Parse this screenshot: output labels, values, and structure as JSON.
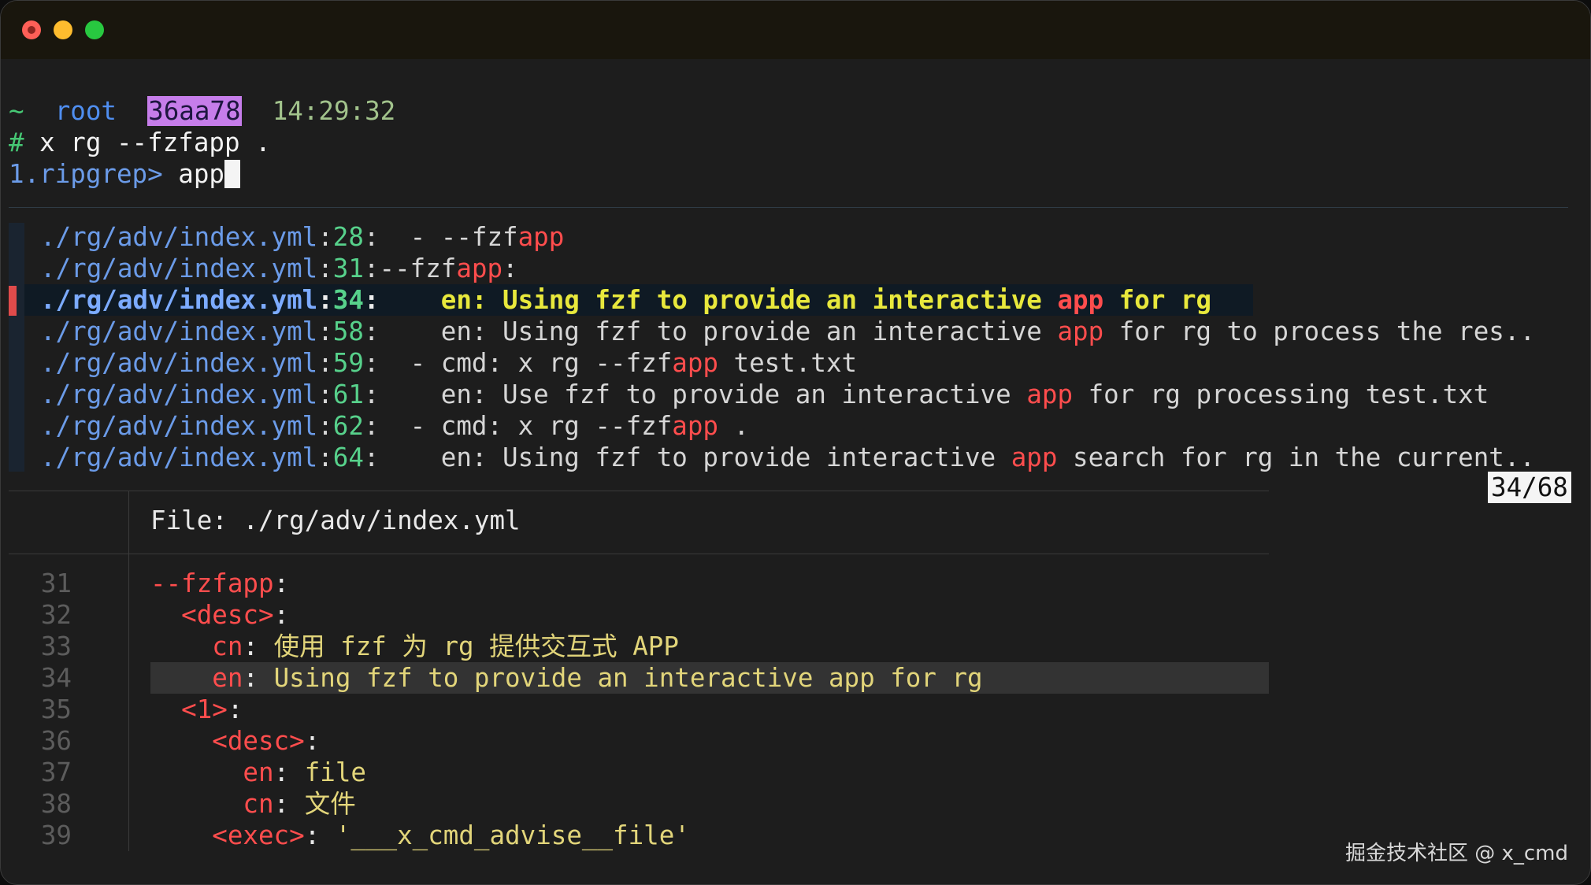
{
  "prompt": {
    "tilde": "~",
    "user": "root",
    "hash": "36aa78",
    "time": "14:29:32",
    "hash_sym": "#",
    "command": "x rg --fzfapp ."
  },
  "input": {
    "prompt_label": "1.ripgrep>",
    "query": "app"
  },
  "results": [
    {
      "path": "./rg/adv/index.yml",
      "line": "28",
      "pre": "  - --fzf",
      "hl": "app",
      "post": ""
    },
    {
      "path": "./rg/adv/index.yml",
      "line": "31",
      "pre": "--fzf",
      "hl": "app",
      "post": ":"
    },
    {
      "path": "./rg/adv/index.yml",
      "line": "34",
      "pre": "    en: Using fzf to provide an interactive ",
      "hl": "app",
      "post": " for rg"
    },
    {
      "path": "./rg/adv/index.yml",
      "line": "58",
      "pre": "    en: Using fzf to provide an interactive ",
      "hl": "app",
      "post": " for rg to process the res.."
    },
    {
      "path": "./rg/adv/index.yml",
      "line": "59",
      "pre": "  - cmd: x rg --fzf",
      "hl": "app",
      "post": " test.txt"
    },
    {
      "path": "./rg/adv/index.yml",
      "line": "61",
      "pre": "    en: Use fzf to provide an interactive ",
      "hl": "app",
      "post": " for rg processing test.txt"
    },
    {
      "path": "./rg/adv/index.yml",
      "line": "62",
      "pre": "  - cmd: x rg --fzf",
      "hl": "app",
      "post": " ."
    },
    {
      "path": "./rg/adv/index.yml",
      "line": "64",
      "pre": "    en: Using fzf to provide interactive ",
      "hl": "app",
      "post": " search for rg in the current.."
    }
  ],
  "counter": "34/68",
  "preview": {
    "file_label": "File:",
    "file_path": "./rg/adv/index.yml",
    "lines": [
      {
        "num": "31",
        "indent": "",
        "key": "--fzfapp",
        "sep": ":",
        "value": ""
      },
      {
        "num": "32",
        "indent": "  ",
        "key": "<desc>",
        "sep": ":",
        "value": ""
      },
      {
        "num": "33",
        "indent": "    ",
        "key": "cn",
        "sep": ": ",
        "value": "使用 fzf 为 rg 提供交互式 APP"
      },
      {
        "num": "34",
        "indent": "    ",
        "key": "en",
        "sep": ": ",
        "value": "Using fzf to provide an interactive app for rg"
      },
      {
        "num": "35",
        "indent": "  ",
        "key": "<1>",
        "sep": ":",
        "value": ""
      },
      {
        "num": "36",
        "indent": "    ",
        "key": "<desc>",
        "sep": ":",
        "value": ""
      },
      {
        "num": "37",
        "indent": "      ",
        "key": "en",
        "sep": ": ",
        "value": "file"
      },
      {
        "num": "38",
        "indent": "      ",
        "key": "cn",
        "sep": ": ",
        "value": "文件"
      },
      {
        "num": "39",
        "indent": "    ",
        "key": "<exec>",
        "sep": ": ",
        "value": "'___x_cmd_advise__file'"
      }
    ]
  },
  "watermark": "掘金技术社区 @ x_cmd",
  "colors": {
    "accent_red": "#ff4d4d",
    "path_blue": "#6b9be8",
    "line_green": "#57d18b",
    "selected_yellow": "#e8e83c",
    "hash_badge": "#c67dea"
  }
}
